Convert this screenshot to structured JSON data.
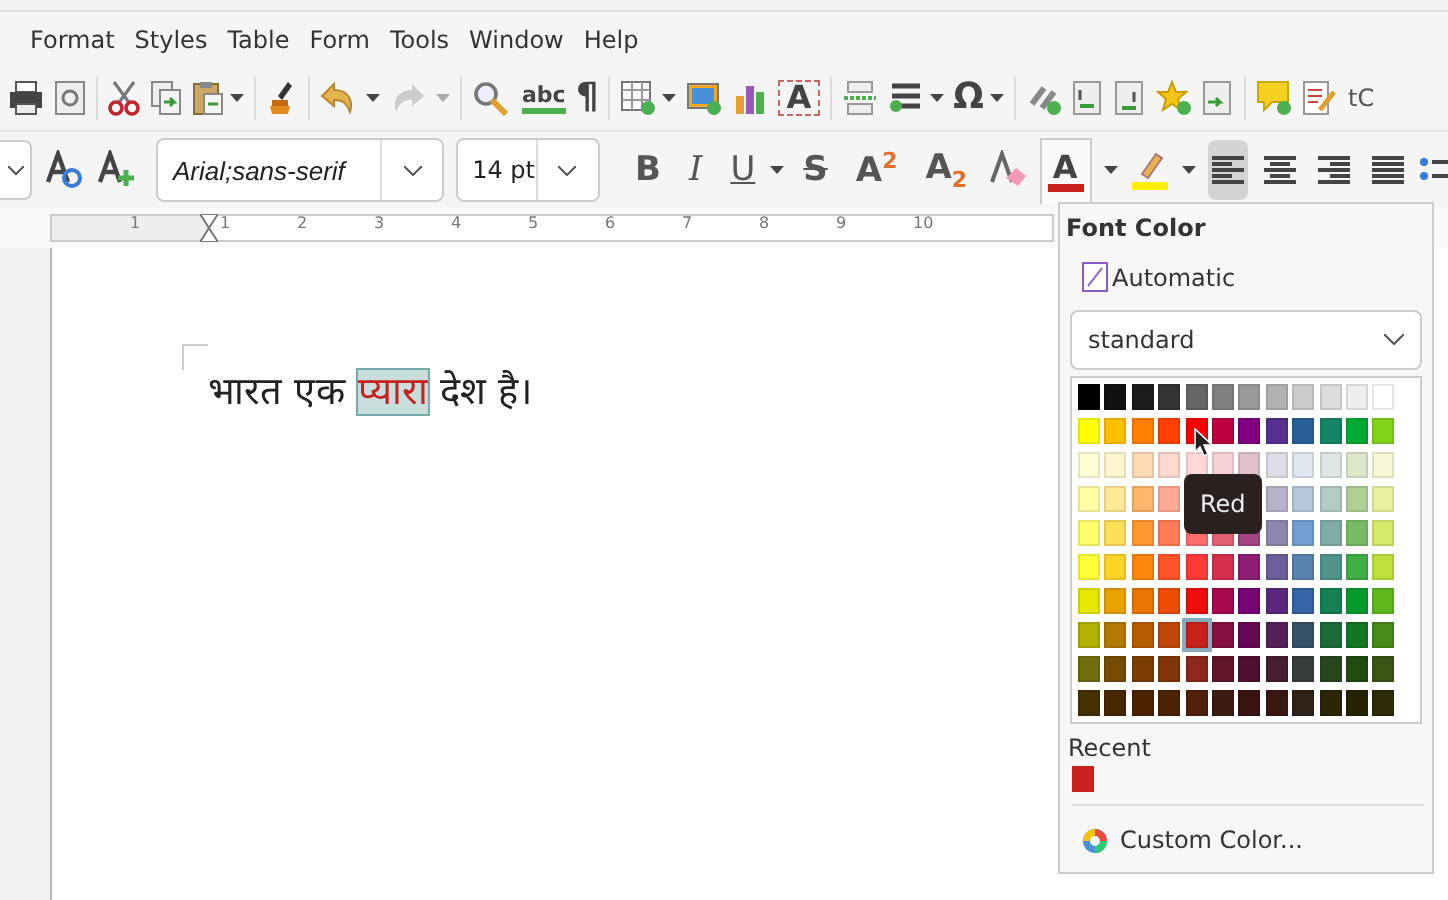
{
  "menubar": {
    "items": [
      "Format",
      "Styles",
      "Table",
      "Form",
      "Tools",
      "Window",
      "Help"
    ]
  },
  "standard_toolbar": {
    "spelling_glyph": "abc",
    "formatting_marks_glyph": "¶",
    "textbox_glyph": "A",
    "special_character_glyph": "Ω",
    "cut_off_label": "tC"
  },
  "formatting_toolbar": {
    "font_name": "Arial;sans-serif",
    "font_size": "14 pt",
    "bold": "B",
    "italic": "I",
    "underline": "U",
    "strikethrough": "S",
    "superscript": "A$^{2}$",
    "subscript": "A$_{2}$",
    "font_color_glyph": "A",
    "alignment": [
      {
        "selected": true
      },
      {
        "selected": false
      },
      {
        "selected": false
      },
      {
        "selected": false
      }
    ]
  },
  "ruler": {
    "labels": [
      "1",
      "1",
      "2",
      "3",
      "4",
      "5",
      "6",
      "7",
      "8",
      "9",
      "10"
    ]
  },
  "document": {
    "segments": [
      {
        "text": "भारत एक ",
        "selected": false
      },
      {
        "text": "प्यारा",
        "selected": true
      },
      {
        "text": " देश है।",
        "selected": false
      }
    ]
  },
  "font_color_popup": {
    "title": "Font Color",
    "automatic": "Automatic",
    "palette_name": "standard",
    "palette": [
      [
        {
          "color": "#000000",
          "selected": false
        },
        {
          "color": "#111111",
          "selected": false
        },
        {
          "color": "#1c1c1c",
          "selected": false
        },
        {
          "color": "#333333",
          "selected": false
        },
        {
          "color": "#666666",
          "selected": false
        },
        {
          "color": "#808080",
          "selected": false
        },
        {
          "color": "#999999",
          "selected": false
        },
        {
          "color": "#b2b2b2",
          "selected": false
        },
        {
          "color": "#cccccc",
          "selected": false
        },
        {
          "color": "#dddddd",
          "selected": false
        },
        {
          "color": "#eeeeee",
          "selected": false
        },
        {
          "color": "#ffffff",
          "selected": false
        }
      ],
      [
        {
          "color": "#ffff00",
          "selected": false
        },
        {
          "color": "#ffbf00",
          "selected": false
        },
        {
          "color": "#ff8000",
          "selected": false
        },
        {
          "color": "#ff4000",
          "selected": false
        },
        {
          "color": "#ff0000",
          "selected": false
        },
        {
          "color": "#bf0041",
          "selected": false
        },
        {
          "color": "#800080",
          "selected": false
        },
        {
          "color": "#55308d",
          "selected": false
        },
        {
          "color": "#2a6099",
          "selected": false
        },
        {
          "color": "#158466",
          "selected": false
        },
        {
          "color": "#00a933",
          "selected": false
        },
        {
          "color": "#81d41a",
          "selected": false
        }
      ],
      [
        {
          "color": "#ffffd7",
          "selected": false
        },
        {
          "color": "#fff5ce",
          "selected": false
        },
        {
          "color": "#ffdbb6",
          "selected": false
        },
        {
          "color": "#ffd8ce",
          "selected": false
        },
        {
          "color": "#ffd7d7",
          "selected": false
        },
        {
          "color": "#f7d1d5",
          "selected": false
        },
        {
          "color": "#e0c2cd",
          "selected": false
        },
        {
          "color": "#dedce6",
          "selected": false
        },
        {
          "color": "#dee6ef",
          "selected": false
        },
        {
          "color": "#dee7e5",
          "selected": false
        },
        {
          "color": "#dde8cb",
          "selected": false
        },
        {
          "color": "#f6f9d4",
          "selected": false
        }
      ],
      {
        "left_of_tooltip": [
          {
            "color": "#ffffa6",
            "selected": false
          },
          {
            "color": "#ffe994",
            "selected": false
          },
          {
            "color": "#ffb66c",
            "selected": false
          },
          {
            "color": "#ffaa95",
            "selected": false
          }
        ],
        "right_of_tooltip": [
          {
            "color": "#b7b3ca",
            "selected": false
          },
          {
            "color": "#b4c7dc",
            "selected": false
          },
          {
            "color": "#b3cac7",
            "selected": false
          },
          {
            "color": "#afd095",
            "selected": false
          },
          {
            "color": "#e8f2a1",
            "selected": false
          }
        ]
      },
      [
        {
          "color": "#ffff6d",
          "selected": false
        },
        {
          "color": "#ffde59",
          "selected": false
        },
        {
          "color": "#ff972f",
          "selected": false
        },
        {
          "color": "#ff7b59",
          "selected": false
        },
        {
          "color": "#ff6d6d",
          "selected": false
        },
        {
          "color": "#e16173",
          "selected": false
        },
        {
          "color": "#a1467e",
          "selected": false
        },
        {
          "color": "#8e86ae",
          "selected": false
        },
        {
          "color": "#729fcf",
          "selected": false
        },
        {
          "color": "#81aca6",
          "selected": false
        },
        {
          "color": "#77bc65",
          "selected": false
        },
        {
          "color": "#d4ea6b",
          "selected": false
        }
      ],
      [
        {
          "color": "#ffff38",
          "selected": false
        },
        {
          "color": "#ffd428",
          "selected": false
        },
        {
          "color": "#ff860d",
          "selected": false
        },
        {
          "color": "#ff5429",
          "selected": false
        },
        {
          "color": "#ff3838",
          "selected": false
        },
        {
          "color": "#d62e4e",
          "selected": false
        },
        {
          "color": "#8d1d75",
          "selected": false
        },
        {
          "color": "#6b5e9b",
          "selected": false
        },
        {
          "color": "#5983b0",
          "selected": false
        },
        {
          "color": "#50938a",
          "selected": false
        },
        {
          "color": "#3faf46",
          "selected": false
        },
        {
          "color": "#bde13a",
          "selected": false
        }
      ],
      [
        {
          "color": "#e6e600",
          "selected": false
        },
        {
          "color": "#e8a202",
          "selected": false
        },
        {
          "color": "#ea7500",
          "selected": false
        },
        {
          "color": "#ed4c05",
          "selected": false
        },
        {
          "color": "#f10d0c",
          "selected": false
        },
        {
          "color": "#a7074b",
          "selected": false
        },
        {
          "color": "#780373",
          "selected": false
        },
        {
          "color": "#5b277d",
          "selected": false
        },
        {
          "color": "#3465a4",
          "selected": false
        },
        {
          "color": "#168253",
          "selected": false
        },
        {
          "color": "#069a2e",
          "selected": false
        },
        {
          "color": "#5eb91e",
          "selected": false
        }
      ],
      [
        {
          "color": "#b2b200",
          "selected": false
        },
        {
          "color": "#b47804",
          "selected": false
        },
        {
          "color": "#b85c00",
          "selected": false
        },
        {
          "color": "#be480a",
          "selected": false
        },
        {
          "color": "#c9211e",
          "selected": true
        },
        {
          "color": "#861141",
          "selected": false
        },
        {
          "color": "#650953",
          "selected": false
        },
        {
          "color": "#55215b",
          "selected": false
        },
        {
          "color": "#355269",
          "selected": false
        },
        {
          "color": "#1e6a39",
          "selected": false
        },
        {
          "color": "#127622",
          "selected": false
        },
        {
          "color": "#468a1a",
          "selected": false
        }
      ],
      [
        {
          "color": "#706e0c",
          "selected": false
        },
        {
          "color": "#784b04",
          "selected": false
        },
        {
          "color": "#7b3d00",
          "selected": false
        },
        {
          "color": "#813709",
          "selected": false
        },
        {
          "color": "#8d281e",
          "selected": false
        },
        {
          "color": "#611729",
          "selected": false
        },
        {
          "color": "#4e102d",
          "selected": false
        },
        {
          "color": "#481d32",
          "selected": false
        },
        {
          "color": "#383d3c",
          "selected": false
        },
        {
          "color": "#28471f",
          "selected": false
        },
        {
          "color": "#224b12",
          "selected": false
        },
        {
          "color": "#395511",
          "selected": false
        }
      ],
      [
        {
          "color": "#443205",
          "selected": false
        },
        {
          "color": "#472702",
          "selected": false
        },
        {
          "color": "#492300",
          "selected": false
        },
        {
          "color": "#4b2204",
          "selected": false
        },
        {
          "color": "#50200d",
          "selected": false
        },
        {
          "color": "#3e1a11",
          "selected": false
        },
        {
          "color": "#3a1410",
          "selected": false
        },
        {
          "color": "#3a1812",
          "selected": false
        },
        {
          "color": "#302218",
          "selected": false
        },
        {
          "color": "#2b2607",
          "selected": false
        },
        {
          "color": "#262303",
          "selected": false
        },
        {
          "color": "#2e2b07",
          "selected": false
        }
      ]
    ],
    "tooltip": "Red",
    "recent_label": "Recent",
    "recent": [
      {
        "color": "#c9211e"
      }
    ],
    "custom_color": "Custom Color..."
  }
}
